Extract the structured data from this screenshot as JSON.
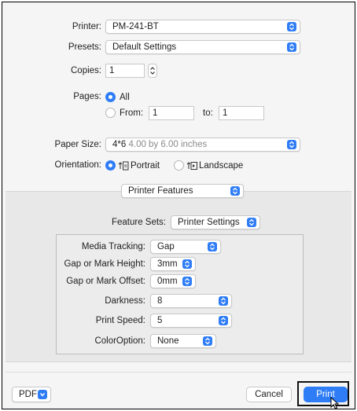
{
  "printer": {
    "label": "Printer:",
    "value": "PM-241-BT"
  },
  "presets": {
    "label": "Presets:",
    "value": "Default Settings"
  },
  "copies": {
    "label": "Copies:",
    "value": "1"
  },
  "pages": {
    "label": "Pages:",
    "all_label": "All",
    "from_label": "From:",
    "from_value": "1",
    "to_label": "to:",
    "to_value": "1",
    "selected": "All"
  },
  "paper_size": {
    "label": "Paper Size:",
    "name": "4*6",
    "dimensions": "4.00 by 6.00 inches"
  },
  "orientation": {
    "label": "Orientation:",
    "portrait_label": "Portrait",
    "landscape_label": "Landscape",
    "selected": "Portrait"
  },
  "section_popup": {
    "value": "Printer Features"
  },
  "feature_sets": {
    "label": "Feature Sets:",
    "value": "Printer Settings"
  },
  "features": [
    {
      "label": "Media Tracking:",
      "value": "Gap"
    },
    {
      "label": "Gap or Mark Height:",
      "value": "3mm"
    },
    {
      "label": "Gap or Mark Offset:",
      "value": "0mm"
    },
    {
      "label": "Darkness:",
      "value": "8"
    },
    {
      "label": "Print Speed:",
      "value": "5"
    },
    {
      "label": "ColorOption:",
      "value": "None"
    }
  ],
  "footer": {
    "pdf_label": "PDF",
    "cancel_label": "Cancel",
    "print_label": "Print"
  },
  "colors": {
    "accent": "#2f7df6",
    "panel_bg": "#f5f5f5",
    "section_bg": "#e8e8e8"
  },
  "icons": {
    "popup": "chevron-updown-icon",
    "stepper": "stepper-arrows-icon",
    "portrait": "portrait-orientation-icon",
    "landscape": "landscape-orientation-icon",
    "pointer": "mouse-pointer-icon"
  }
}
